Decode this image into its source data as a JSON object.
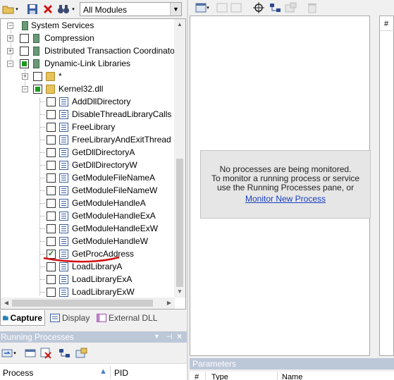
{
  "toolbar": {
    "module_filter_value": "All Modules"
  },
  "tree": {
    "system_services": "System Services",
    "compression": "Compression",
    "distributed_txn": "Distributed Transaction Coordinato",
    "dll": "Dynamic-Link Libraries",
    "wildcard": "*",
    "kernel32": "Kernel32.dll",
    "functions": [
      {
        "label": "AddDllDirectory",
        "checked": false
      },
      {
        "label": "DisableThreadLibraryCalls",
        "checked": false
      },
      {
        "label": "FreeLibrary",
        "checked": false
      },
      {
        "label": "FreeLibraryAndExitThread",
        "checked": false
      },
      {
        "label": "GetDllDirectoryA",
        "checked": false
      },
      {
        "label": "GetDllDirectoryW",
        "checked": false
      },
      {
        "label": "GetModuleFileNameA",
        "checked": false
      },
      {
        "label": "GetModuleFileNameW",
        "checked": false
      },
      {
        "label": "GetModuleHandleA",
        "checked": false
      },
      {
        "label": "GetModuleHandleExA",
        "checked": false
      },
      {
        "label": "GetModuleHandleExW",
        "checked": false
      },
      {
        "label": "GetModuleHandleW",
        "checked": false
      },
      {
        "label": "GetProcAddress",
        "checked": true
      },
      {
        "label": "LoadLibraryA",
        "checked": false
      },
      {
        "label": "LoadLibraryExA",
        "checked": false
      },
      {
        "label": "LoadLibraryExW",
        "checked": false
      }
    ]
  },
  "tabs": {
    "capture": "Capture",
    "display": "Display",
    "external_dll": "External DLL"
  },
  "running_processes": {
    "title": "Running Processes",
    "col_process": "Process",
    "col_pid": "PID"
  },
  "monitor": {
    "line1": "No processes are being monitored.",
    "line2": "To monitor a running process or service",
    "line3": "use the Running Processes pane, or",
    "link": "Monitor New Process"
  },
  "side_column_header": "#",
  "parameters": {
    "title": "Parameters",
    "col_num": "#",
    "col_type": "Type",
    "col_name": "Name"
  },
  "colors": {
    "panel_title_bg": "#bcc7d8",
    "link": "#1a3fbf",
    "annotation_red": "#d01010"
  }
}
